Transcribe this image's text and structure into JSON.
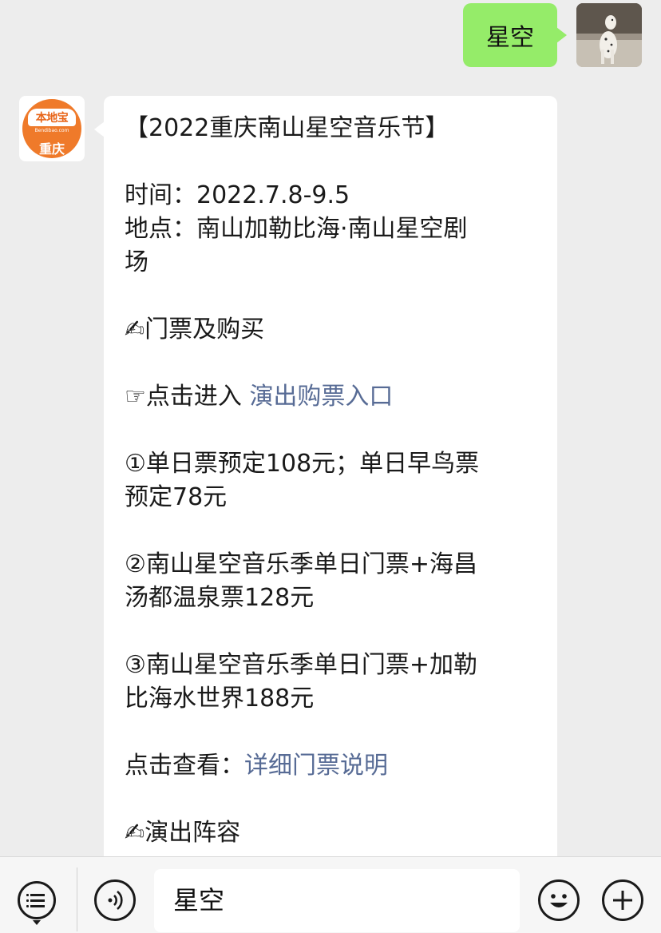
{
  "user_message": {
    "text": "星空"
  },
  "bot_message": {
    "avatar": {
      "brand": "本地宝",
      "site": "Bendibao.com",
      "city": "重庆"
    },
    "title": "【2022重庆南山星空音乐节】",
    "time_line": "时间：2022.7.8-9.5",
    "place_line_1": "地点：南山加勒比海·南山星空剧",
    "place_line_2": "场",
    "ticket_heading": "✍门票及购买",
    "enter_prefix": "☞点击进入 ",
    "enter_link": "演出购票入口",
    "item1_line1": "①单日票预定108元；单日早鸟票",
    "item1_line2": "预定78元",
    "item2_line1": "②南山星空音乐季单日门票+海昌",
    "item2_line2": "汤都温泉票128元",
    "item3_line1": "③南山星空音乐季单日门票+加勒",
    "item3_line2": "比海水世界188元",
    "view_prefix": "点击查看：",
    "view_link": "详细门票说明",
    "lineup_heading": "✍演出阵容"
  },
  "input_bar": {
    "text_value": "星空",
    "icons": [
      "menu-icon",
      "voice-icon",
      "emoji-icon",
      "plus-icon"
    ]
  },
  "colors": {
    "background": "#ededed",
    "user_bubble": "#95ec69",
    "link": "#576b95",
    "logo_orange": "#ef7a2a"
  }
}
